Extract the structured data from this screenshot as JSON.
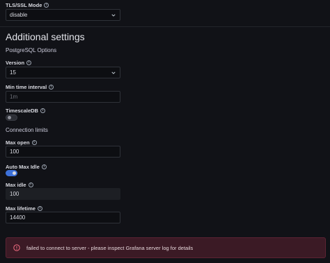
{
  "tls": {
    "label": "TLS/SSL Mode",
    "value": "disable"
  },
  "additional": {
    "title": "Additional settings",
    "postgres_title": "PostgreSQL Options",
    "version": {
      "label": "Version",
      "value": "15"
    },
    "min_time_interval": {
      "label": "Min time interval",
      "placeholder": "1m"
    },
    "timescaledb": {
      "label": "TimescaleDB",
      "enabled": false
    }
  },
  "connection_limits": {
    "title": "Connection limits",
    "max_open": {
      "label": "Max open",
      "value": "100"
    },
    "auto_max_idle": {
      "label": "Auto Max Idle",
      "enabled": true
    },
    "max_idle": {
      "label": "Max idle",
      "value": "100"
    },
    "max_lifetime": {
      "label": "Max lifetime",
      "value": "14400"
    }
  },
  "alert": {
    "message": "failed to connect to server - please inspect Grafana server log for details",
    "color": "#5c2333"
  },
  "icons": {
    "info": "info-circle-icon",
    "chevron": "chevron-down-icon",
    "error": "exclamation-circle-icon"
  }
}
